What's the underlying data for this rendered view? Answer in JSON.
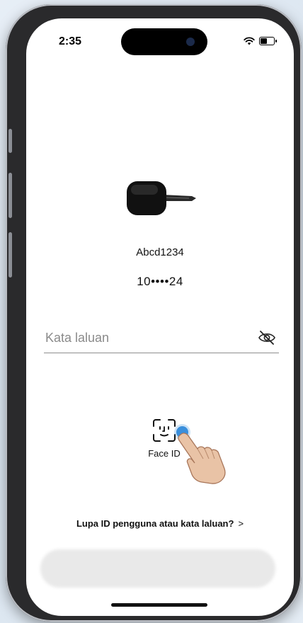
{
  "status_bar": {
    "time": "2:35"
  },
  "account": {
    "username": "Abcd1234",
    "phone_masked": "10••••24"
  },
  "password": {
    "placeholder": "Kata laluan",
    "value": ""
  },
  "face_id": {
    "label": "Face ID"
  },
  "forgot": {
    "label": "Lupa ID pengguna atau kata laluan?",
    "chevron": ">"
  },
  "login_button": {
    "label": ""
  },
  "icons": {
    "key": "car-key-icon",
    "eye": "eye-off-icon",
    "face_id": "face-id-icon",
    "hand": "pointing-hand-icon"
  },
  "colors": {
    "tap_indicator": "#3a8fdc",
    "background": "#ffffff"
  }
}
